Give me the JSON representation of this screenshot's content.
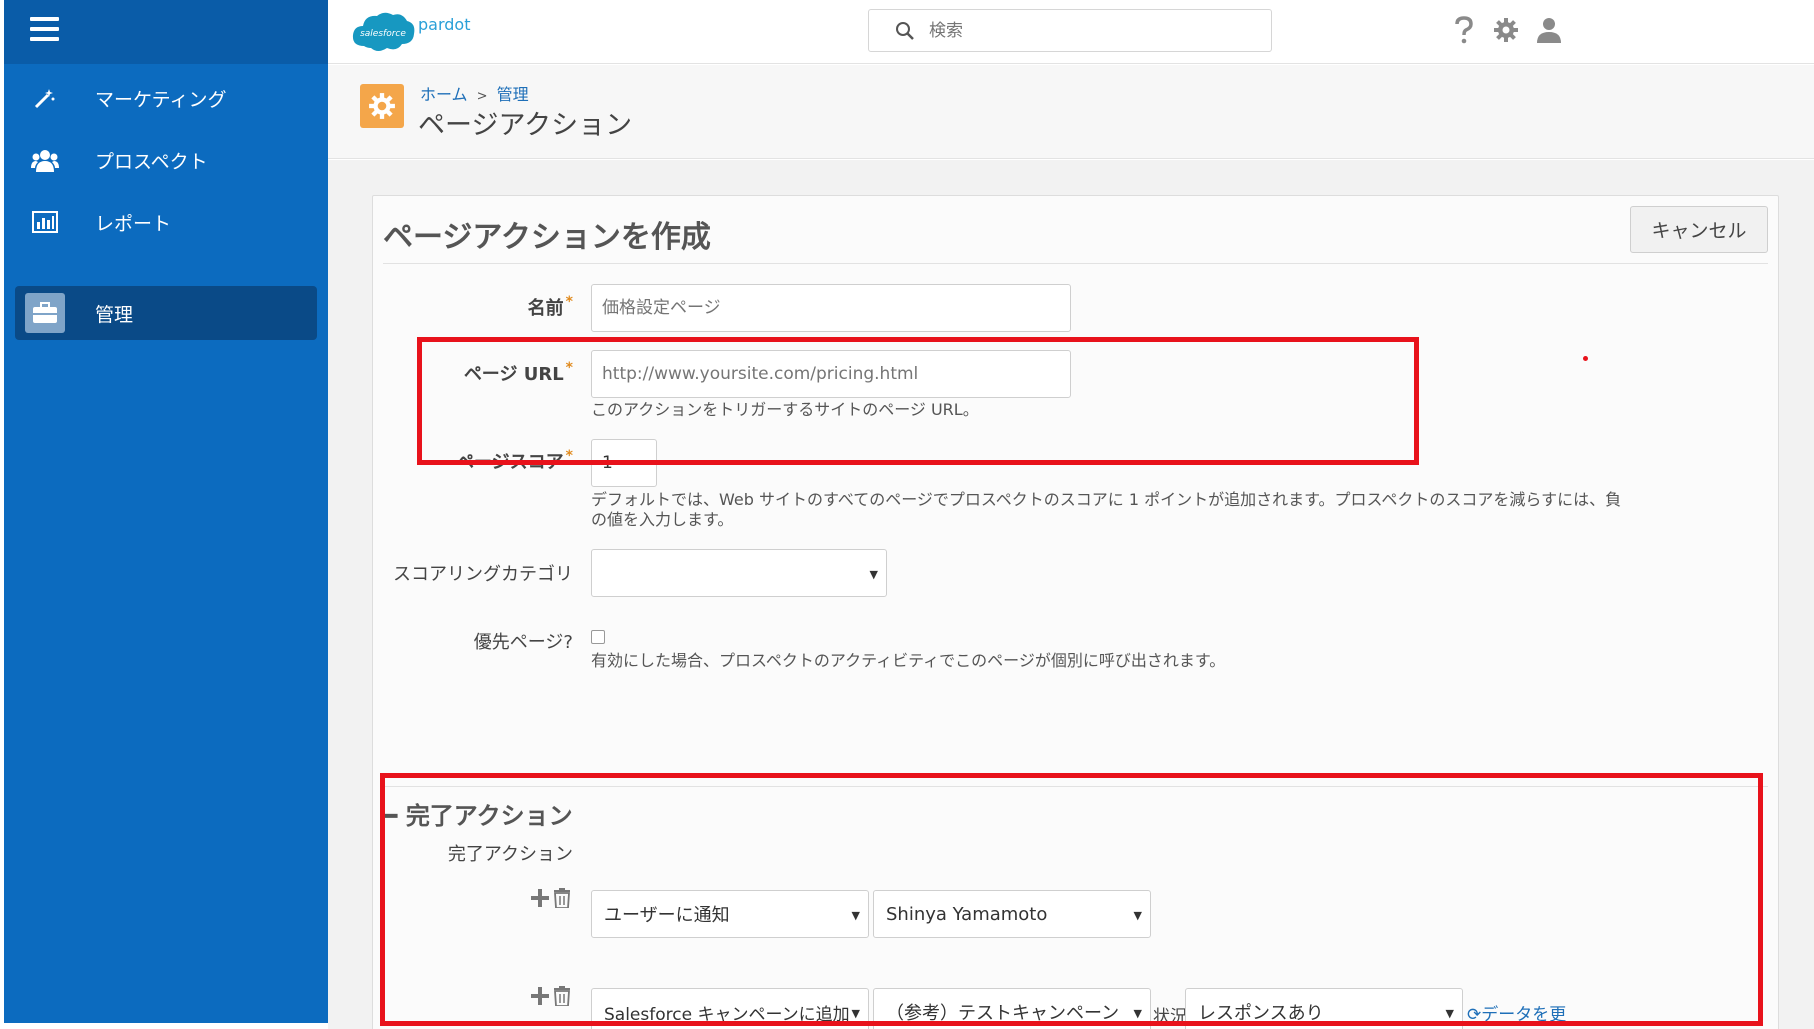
{
  "header": {
    "logo_brand": "salesforce",
    "logo_product": "pardot",
    "search_placeholder": "検索"
  },
  "sidebar": {
    "items": [
      {
        "label": "マーケティング",
        "icon": "magic-wand-icon"
      },
      {
        "label": "プロスペクト",
        "icon": "people-icon"
      },
      {
        "label": "レポート",
        "icon": "chart-icon"
      },
      {
        "label": "管理",
        "icon": "briefcase-icon",
        "active": true
      }
    ]
  },
  "breadcrumb": {
    "home": "ホーム",
    "separator": ">",
    "current": "管理"
  },
  "page_title": "ページアクション",
  "form": {
    "title": "ページアクションを作成",
    "cancel_label": "キャンセル",
    "name_label": "名前",
    "name_placeholder": "価格設定ページ",
    "url_label": "ページ URL",
    "url_placeholder": "http://www.yoursite.com/pricing.html",
    "url_help": "このアクションをトリガーするサイトのページ URL。",
    "score_label": "ページスコア",
    "score_value": "1",
    "score_help_line1": "デフォルトでは、Web サイトのすべてのページでプロスペクトのスコアに 1 ポイントが追加されます。プロスペクトのスコアを減らすには、負",
    "score_help_line2": "の値を入力します。",
    "category_label": "スコアリングカテゴリ",
    "category_value": "",
    "priority_label": "優先ページ?",
    "priority_checked": false,
    "priority_help": "有効にした場合、プロスペクトのアクティビティでこのページが個別に呼び出されます。"
  },
  "completion": {
    "section_title": "完了アクション",
    "row_label": "完了アクション",
    "actions": [
      {
        "action": "ユーザーに通知",
        "target": "Shinya Yamamoto"
      },
      {
        "action": "Salesforce キャンペーンに追加",
        "target": "（参考）テストキャンペーン",
        "status_label": "状況",
        "status": "レスポンスあり",
        "refresh": "データを更"
      }
    ]
  },
  "colors": {
    "sidebar": "#0c6bbf",
    "accent_link": "#1e6fb8",
    "title_icon": "#f4a64a",
    "highlight": "#e8121b"
  }
}
